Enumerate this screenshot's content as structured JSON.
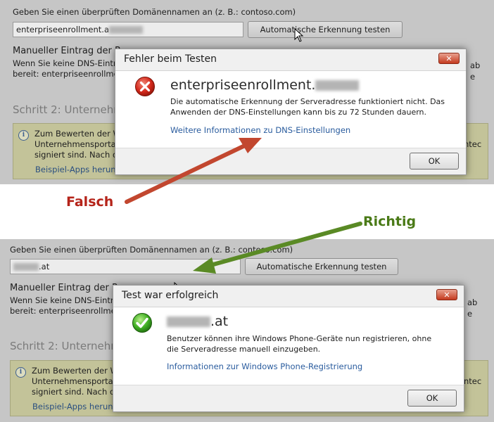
{
  "top": {
    "domain_prompt": "Geben Sie einen überprüften Domänennamen an (z. B.: contoso.com)",
    "domain_value": "enterpriseenrollment.a",
    "test_button": "Automatische Erkennung testen",
    "manual_heading_visible": "Manueller Eintrag der R",
    "manual_line1_visible": "Wenn Sie keine DNS-Einträ",
    "manual_line2_visible": "bereit: enterpriseenrollment",
    "step2_visible": "Schritt 2: Unternehm",
    "info_line1_visible": "Zum Bewerten der Wi",
    "info_line2_visible": "Unternehmensportal-",
    "info_line3_visible": "signiert sind. Nach de",
    "info_link_visible": "Beispiel-Apps herunte",
    "info_right_fragment": "ntec",
    "right_edge_fragment1": "ab",
    "right_edge_fragment2": "e",
    "dialog": {
      "title": "Fehler beim Testen",
      "close_label": "✕",
      "icon": "error-icon",
      "domain": "enterpriseenrollment.",
      "message": "Die automatische Erkennung der Serveradresse funktioniert nicht. Das Anwenden der DNS-Einstellungen kann bis zu 72 Stunden dauern.",
      "link": "Weitere Informationen zu DNS-Einstellungen",
      "ok": "OK"
    }
  },
  "annotations": {
    "wrong": "Falsch",
    "right": "Richtig",
    "wrong_color": "#b5241a",
    "right_color": "#4a7a17"
  },
  "bottom": {
    "domain_prompt": "Geben Sie einen überprüften Domänennamen an (z. B.: contoso.com)",
    "domain_value": ".at",
    "test_button": "Automatische Erkennung testen",
    "manual_heading_visible": "Manueller Eintrag der R",
    "manual_line1_visible": "Wenn Sie keine DNS-Einträ",
    "manual_line2_visible": "bereit: enterpriseenrollment",
    "step2_visible": "Schritt 2: Unternehm",
    "info_line1_visible": "Zum Bewerten der Wi",
    "info_line2_visible": "Unternehmensportal-",
    "info_line3_visible": "signiert sind. Nach de",
    "info_link_visible": "Beispiel-Apps herunte",
    "info_right_fragment": "ntec",
    "right_edge_fragment1": "ab",
    "right_edge_fragment2": "e",
    "dialog": {
      "title": "Test war erfolgreich",
      "close_label": "✕",
      "icon": "success-check-icon",
      "domain": ".at",
      "message": "Benutzer können ihre Windows Phone-Geräte nun registrieren, ohne die Serveradresse manuell einzugeben.",
      "link": "Informationen zur Windows Phone-Registrierung",
      "ok": "OK"
    }
  }
}
